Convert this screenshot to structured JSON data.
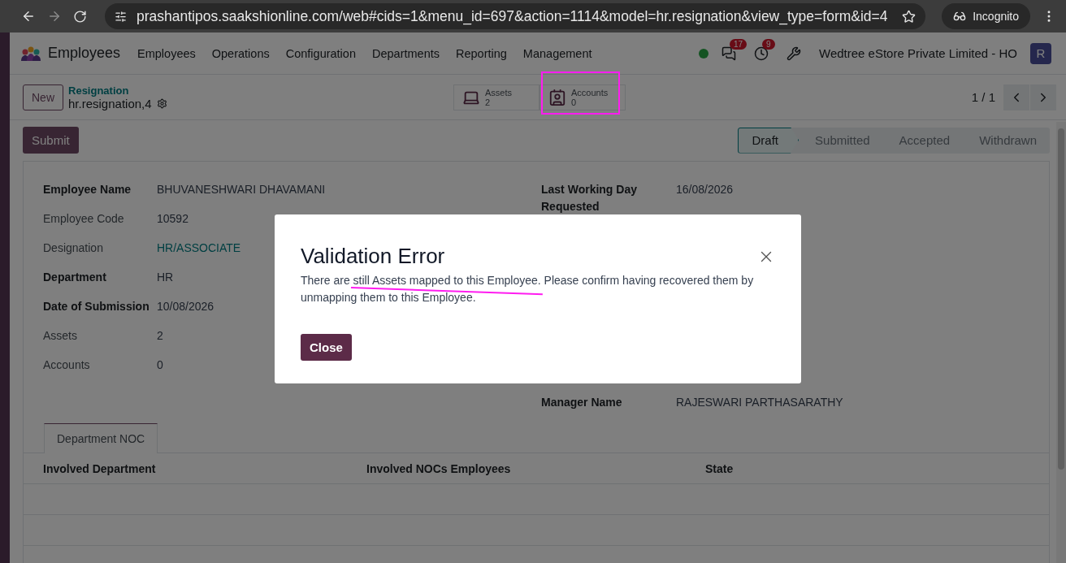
{
  "browser": {
    "url": "prashantipos.saakshionline.com/web#cids=1&menu_id=697&action=1114&model=hr.resignation&view_type=form&id=4",
    "mode_label": "Incognito"
  },
  "navbar": {
    "app_name": "Employees",
    "menu": [
      "Employees",
      "Operations",
      "Configuration",
      "Departments",
      "Reporting",
      "Management"
    ],
    "messages_badge": "17",
    "activities_badge": "9",
    "company": "Wedtree eStore Private Limited - HO",
    "avatar_letter": "R"
  },
  "control_panel": {
    "new_button": "New",
    "breadcrumb": "Resignation",
    "record": "hr.resignation,4",
    "smart_buttons": [
      {
        "kind": "laptop",
        "label": "Assets",
        "value": "2"
      },
      {
        "kind": "card",
        "label": "Accounts",
        "value": "0"
      }
    ],
    "pager": "1 / 1"
  },
  "submit_button": "Submit",
  "stages": [
    {
      "label": "Draft",
      "selected": true
    },
    {
      "label": "Submitted",
      "selected": false
    },
    {
      "label": "Accepted",
      "selected": false
    },
    {
      "label": "Withdrawn",
      "selected": false
    }
  ],
  "left_fields": [
    {
      "label": "Employee Name",
      "value": "BHUVANESHWARI DHAVAMANI",
      "bold": true,
      "kind": "text"
    },
    {
      "label": "Employee Code",
      "value": "10592",
      "bold": false,
      "kind": "text"
    },
    {
      "label": "Designation",
      "value": "HR/ASSOCIATE",
      "bold": false,
      "kind": "link"
    },
    {
      "label": "Department",
      "value": "HR",
      "bold": true,
      "kind": "text"
    },
    {
      "label": "Date of Submission",
      "value": "10/08/2026",
      "bold": true,
      "kind": "text"
    },
    {
      "label": "Assets",
      "value": "2",
      "bold": false,
      "kind": "text"
    },
    {
      "label": "Accounts",
      "value": "0",
      "bold": false,
      "kind": "text"
    }
  ],
  "right_fields": [
    {
      "label": "Last Working Day Requested",
      "value": "16/08/2026",
      "bold": true,
      "kind": "text"
    },
    {
      "label": "Manager Name",
      "value": "RAJESWARI PARTHASARATHY",
      "bold": true,
      "kind": "text"
    }
  ],
  "tabs": [
    {
      "label": "Department NOC",
      "selected": true
    }
  ],
  "table": {
    "columns": [
      "Involved Department",
      "Involved NOCs Employees",
      "State"
    ]
  },
  "dialog": {
    "title": "Validation Error",
    "message": "There are still Assets mapped to this Employee. Please confirm having recovered them by unmapping them to this Employee.",
    "button": "Close"
  }
}
